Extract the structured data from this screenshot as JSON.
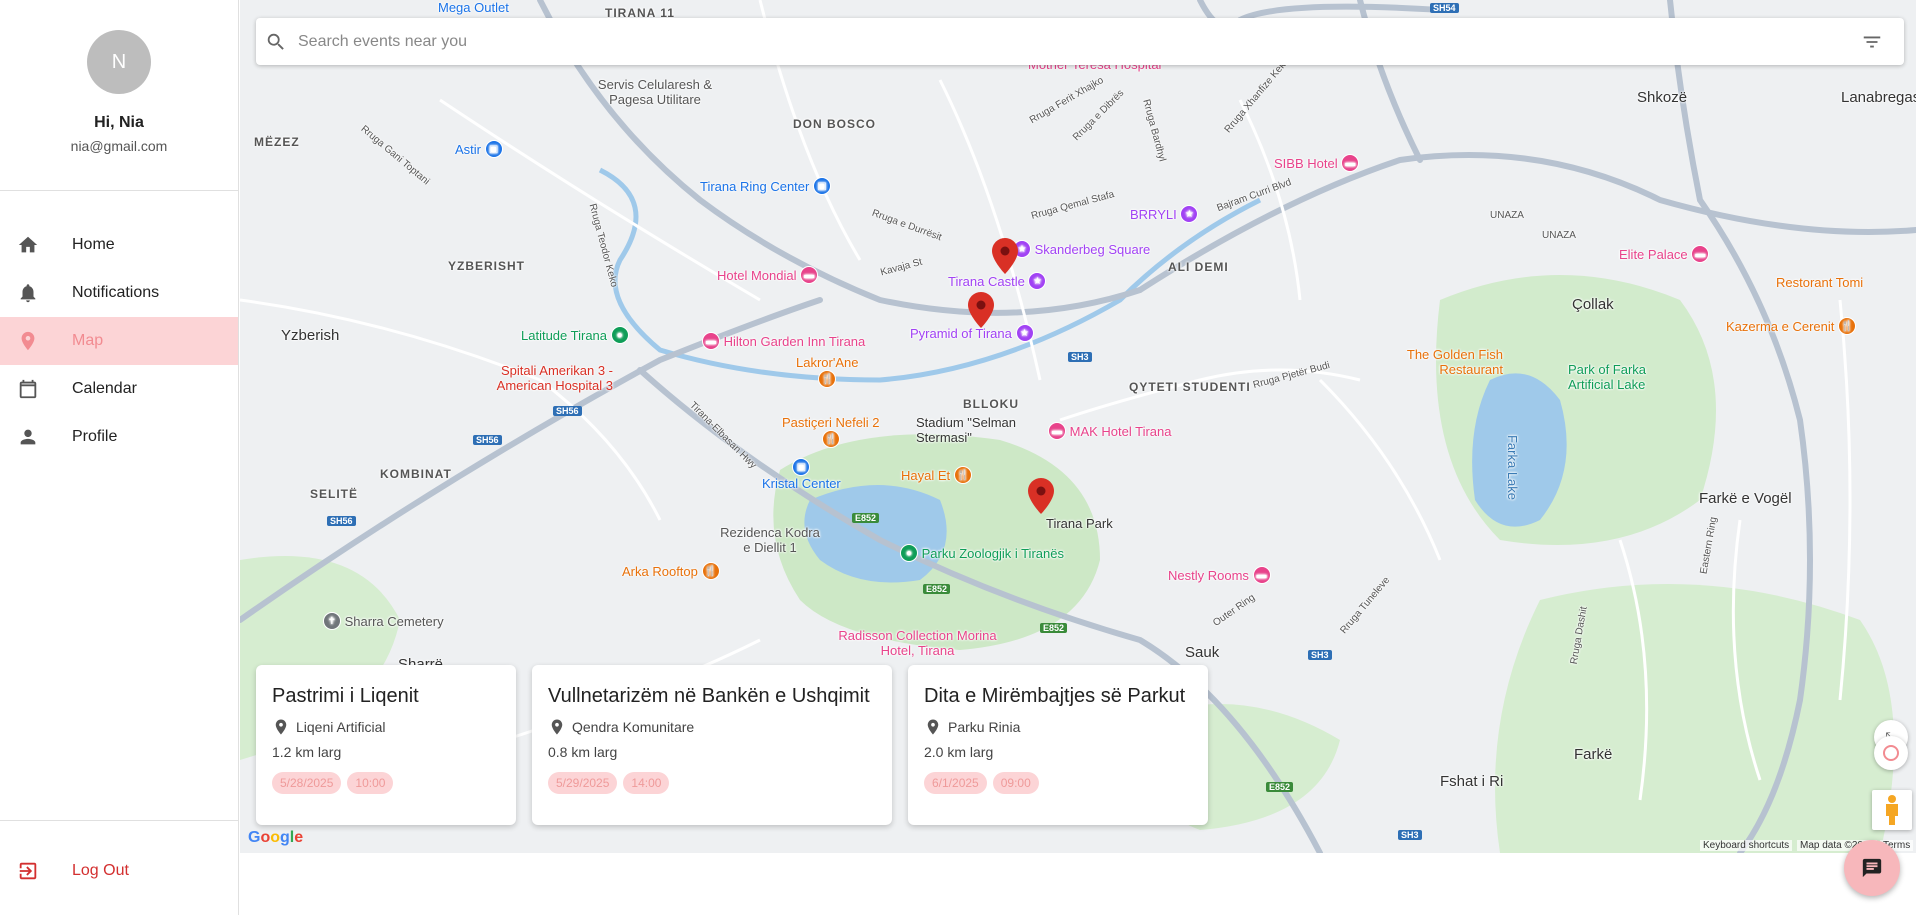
{
  "profile": {
    "initial": "N",
    "greeting": "Hi, Nia",
    "email": "nia@gmail.com"
  },
  "nav": {
    "items": [
      {
        "label": "Home",
        "icon": "home-icon"
      },
      {
        "label": "Notifications",
        "icon": "bell-icon"
      },
      {
        "label": "Map",
        "icon": "map-pin-icon",
        "active": true
      },
      {
        "label": "Calendar",
        "icon": "calendar-icon"
      },
      {
        "label": "Profile",
        "icon": "person-icon"
      }
    ],
    "logout": "Log Out"
  },
  "search": {
    "placeholder": "Search events near you"
  },
  "map": {
    "areas": [
      "TIRANA 11",
      "DON BOSCO",
      "MËZEZ",
      "YZBERISHT",
      "ALI DEMI",
      "BLLOKU",
      "QYTETI STUDENTI",
      "KOMBINAT",
      "SELITË",
      "UNAZA"
    ],
    "towns": [
      "Shkozë",
      "Lanabregas",
      "Yzberish",
      "Çollak",
      "Farkë e Vogël",
      "Sauk",
      "Fshat i Ri",
      "Farkë",
      "Sharrë"
    ],
    "pois": [
      {
        "name": "Skanderbeg Square",
        "color": "#a142f4"
      },
      {
        "name": "Tirana Castle",
        "color": "#a142f4"
      },
      {
        "name": "Pyramid of Tirana",
        "color": "#a142f4"
      },
      {
        "name": "Tirana Park",
        "color": "#34a853"
      },
      {
        "name": "Hotel Mondial",
        "color": "#e8438b"
      },
      {
        "name": "Hilton Garden Inn Tirana",
        "color": "#e8438b"
      },
      {
        "name": "Tirana Ring Center",
        "color": "#1a73e8"
      },
      {
        "name": "Astir",
        "color": "#1a73e8"
      },
      {
        "name": "Kristal Center",
        "color": "#1a73e8"
      },
      {
        "name": "Latitude Tirana",
        "color": "#0f9d58"
      },
      {
        "name": "Lakror'Ane",
        "color": "#e8710a"
      },
      {
        "name": "Pastiçeri Nefeli 2",
        "color": "#e8710a"
      },
      {
        "name": "Hayal Et",
        "color": "#e8710a"
      },
      {
        "name": "Arka Rooftop",
        "color": "#e8710a"
      },
      {
        "name": "The Golden Fish Restaurant",
        "color": "#e8710a"
      },
      {
        "name": "Kazerma e Cerenit",
        "color": "#e8710a"
      },
      {
        "name": "Restorant Tomi",
        "color": "#e8710a"
      },
      {
        "name": "MAK Hotel Tirana",
        "color": "#e8438b"
      },
      {
        "name": "Nestly Rooms",
        "color": "#e8438b"
      },
      {
        "name": "Radisson Collection Morina Hotel, Tirana",
        "color": "#e8438b"
      },
      {
        "name": "SIBB Hotel",
        "color": "#e8438b"
      },
      {
        "name": "Elite Palace",
        "color": "#e8438b"
      },
      {
        "name": "BRRYLI",
        "color": "#a142f4"
      },
      {
        "name": "Mother Teresa Hospital",
        "color": "#e8438b"
      },
      {
        "name": "Spitali Amerikan 3 - American Hospital 3",
        "color": "#d93025"
      },
      {
        "name": "Stadium \"Selman Stermasi\"",
        "color": "#0f9d58"
      },
      {
        "name": "Parku Zoologjik i Tiranës",
        "color": "#0f9d58"
      },
      {
        "name": "Servis Celularesh & Pagesa Utilitare",
        "color": "#70757a"
      },
      {
        "name": "Rezidenca Kodra e Diellit 1",
        "color": "#70757a"
      },
      {
        "name": "Sharra Cemetery",
        "color": "#70757a"
      },
      {
        "name": "Park of Farka Artificial Lake",
        "color": "#0f9d58"
      },
      {
        "name": "Farka Lake",
        "color": "#4a90c8"
      },
      {
        "name": "Mega Outlet",
        "color": "#1a73e8"
      }
    ],
    "roads": [
      "Kavaja St",
      "Rruga e Durrësit",
      "Tirana-Elbasan Hwy",
      "Bajram Curri Blvd",
      "Rruga Qemal Stafa",
      "Rruga e Dibrës",
      "Rruga Ferit Xhajko",
      "Rruga Bardhyl",
      "Rruga Xhanfize Keko",
      "Rruga Pjetër Budi",
      "Rruga Gani Toptani",
      "Rruga Teodor Keko",
      "Outer Ring",
      "Rruga Tuneleve",
      "Eastern Ring",
      "UNAZA",
      "Rruga Dashit"
    ],
    "shields": [
      "SH54",
      "SH3",
      "SH56",
      "SH56",
      "SH56",
      "E852",
      "E852",
      "E852",
      "E852",
      "SH3",
      "SH3"
    ],
    "google": "Google",
    "attribution": [
      "Keyboard shortcuts",
      "Map data ©2025",
      "Terms"
    ]
  },
  "events": [
    {
      "title": "Pastrimi i Liqenit",
      "location": "Liqeni Artificial",
      "distance": "1.2 km larg",
      "date": "5/28/2025",
      "time": "10:00"
    },
    {
      "title": "Vullnetarizëm në Bankën e Ushqimit",
      "location": "Qendra Komunitare",
      "distance": "0.8 km larg",
      "date": "5/29/2025",
      "time": "14:00"
    },
    {
      "title": "Dita e Mirëmbajtjes së Parkut",
      "location": "Parku Rinia",
      "distance": "2.0 km larg",
      "date": "6/1/2025",
      "time": "09:00"
    }
  ],
  "colors": {
    "accent": "#f28b91",
    "active_bg": "#fcd4d6",
    "logout": "#d32f2f",
    "pin": "#d93025"
  }
}
